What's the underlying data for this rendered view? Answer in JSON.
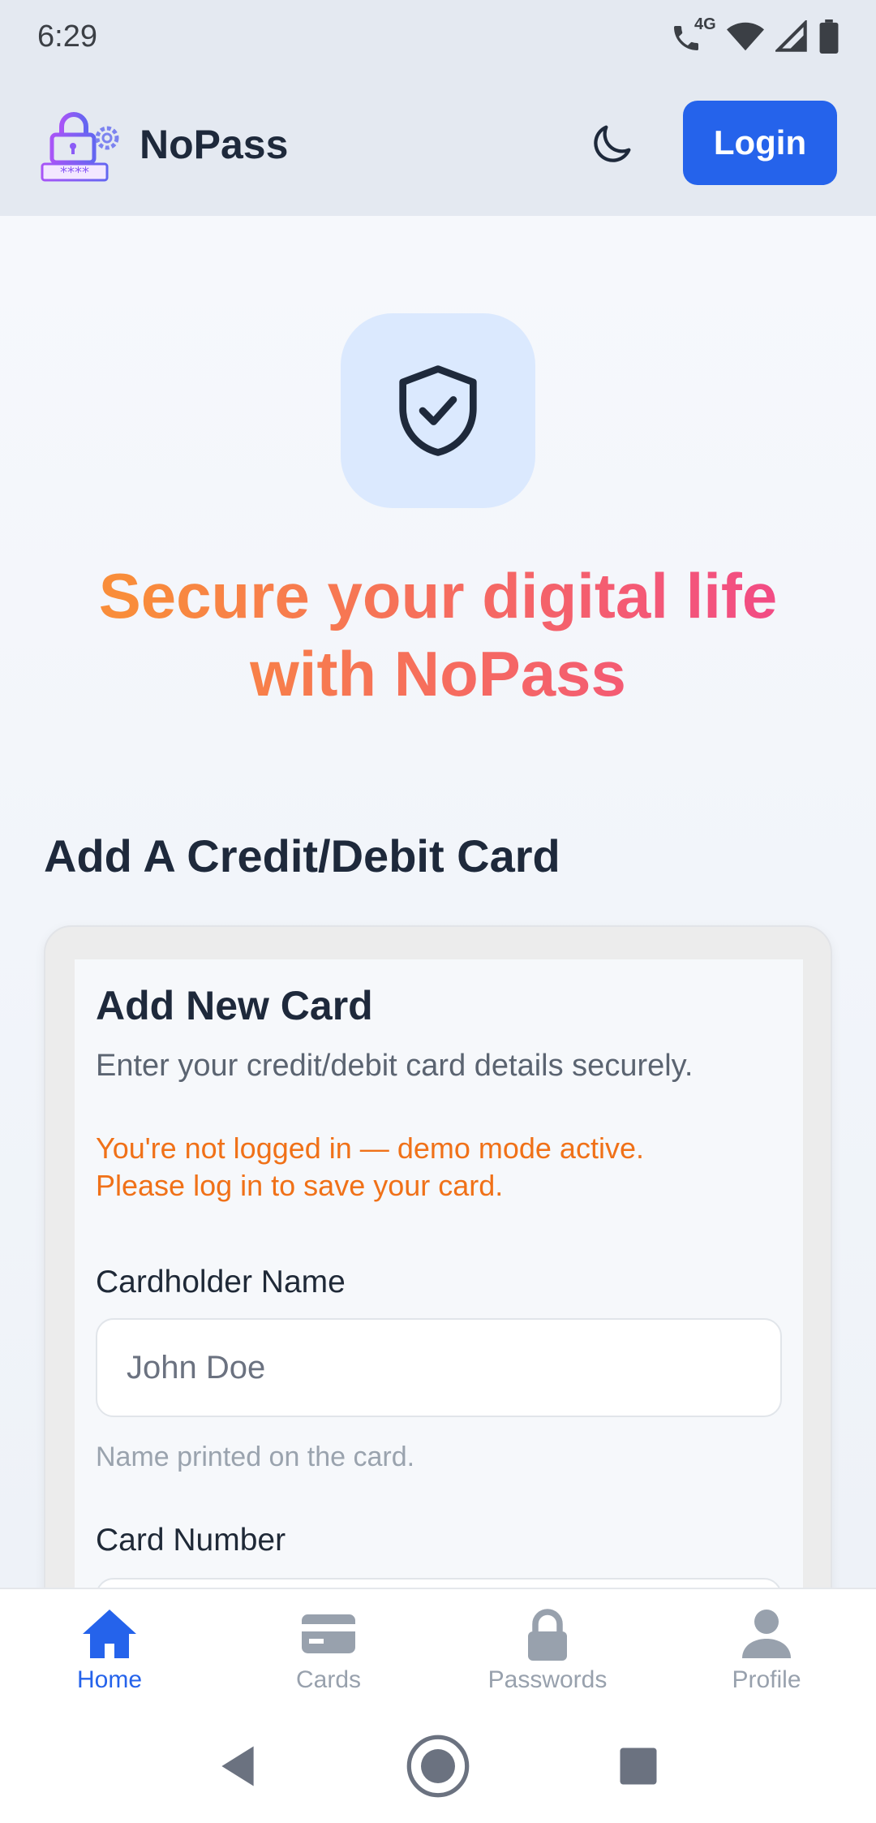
{
  "status": {
    "time": "6:29",
    "network": "4G"
  },
  "header": {
    "brand": "NoPass",
    "login_label": "Login"
  },
  "hero": {
    "tagline_line1": "Secure your digital life",
    "tagline_line2": "with NoPass"
  },
  "section": {
    "title": "Add A Credit/Debit Card"
  },
  "form": {
    "title": "Add New Card",
    "subtitle": "Enter your credit/debit card details securely.",
    "warning_line1": "You're not logged in — demo mode active.",
    "warning_line2": "Please log in to save your card.",
    "name_label": "Cardholder Name",
    "name_placeholder": "John Doe",
    "name_hint": "Name printed on the card.",
    "number_label": "Card Number"
  },
  "nav": {
    "home": "Home",
    "cards": "Cards",
    "passwords": "Passwords",
    "profile": "Profile"
  },
  "colors": {
    "accent": "#2563eb",
    "warning": "#f07118",
    "gradient_start": "#f98d3a",
    "gradient_end": "#f24a86"
  }
}
